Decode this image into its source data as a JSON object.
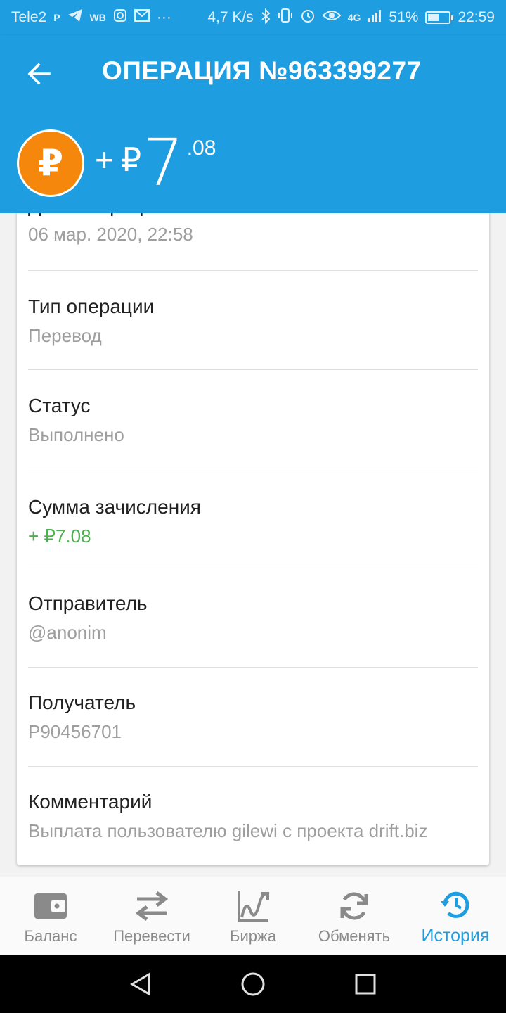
{
  "status_bar": {
    "carrier": "Tele2",
    "app_icons": [
      "parking-icon",
      "telegram-icon",
      "wb-icon",
      "instagram-icon",
      "gmail-icon",
      "more-dots-icon"
    ],
    "wb_text": "WB",
    "more": "···",
    "speed": "4,7 K/s",
    "network": "4G",
    "battery_percent": "51%",
    "battery_level": 0.51,
    "time": "22:59"
  },
  "app_bar": {
    "title": "ОПЕРАЦИЯ №963399277"
  },
  "amount": {
    "sign": "+",
    "currency_symbol": "₽",
    "integer": "7",
    "fraction": ".08",
    "coin_symbol": "₽",
    "coin_color": "#f5870c"
  },
  "details": [
    {
      "label": "Дата операции",
      "value": "06 мар. 2020, 22:58"
    },
    {
      "label": "Тип операции",
      "value": "Перевод"
    },
    {
      "label": "Статус",
      "value": "Выполнено"
    },
    {
      "label": "Сумма зачисления",
      "value": "+ ₽7.08"
    },
    {
      "label": "Отправитель",
      "value": "@anonim"
    },
    {
      "label": "Получатель",
      "value": "P90456701"
    },
    {
      "label": "Комментарий",
      "value": "Выплата пользователю gilewi с проекта drift.biz"
    }
  ],
  "bottom_nav": {
    "items": [
      {
        "label": "Баланс",
        "icon": "wallet-icon"
      },
      {
        "label": "Перевести",
        "icon": "transfer-arrows-icon"
      },
      {
        "label": "Биржа",
        "icon": "chart-icon"
      },
      {
        "label": "Обменять",
        "icon": "exchange-icon"
      },
      {
        "label": "История",
        "icon": "history-icon",
        "active": true
      }
    ]
  },
  "colors": {
    "primary": "#1e9ee0",
    "positive": "#4caf50",
    "muted": "#9e9e9e"
  }
}
